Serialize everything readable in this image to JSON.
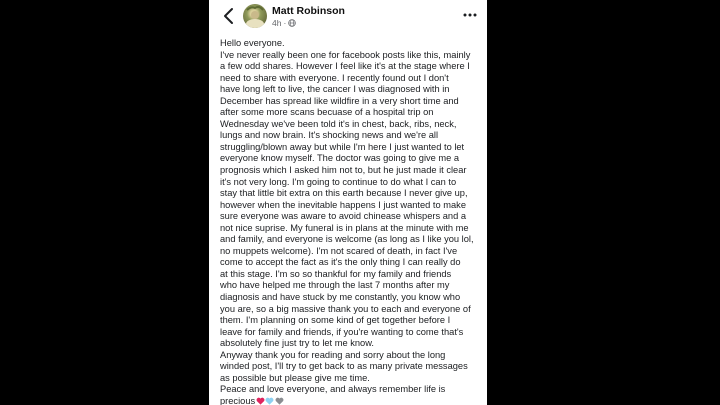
{
  "post": {
    "author": "Matt Robinson",
    "timestamp": "4h",
    "separator": "·",
    "privacy_icon": "globe-icon",
    "lines": [
      "Hello everyone.",
      "I've never really been one for facebook posts like this, mainly",
      "a few odd shares. However I feel like it's at the stage where I",
      "need to share with everyone. I recently found out I don't",
      "have long left to live, the cancer I was diagnosed with in",
      "December has spread like wildfire in a very short time and",
      "after some more scans becuase of a hospital trip on",
      "Wednesday we've been told it's in chest, back, ribs, neck,",
      "lungs and now brain. It's shocking news and we're all",
      "struggling/blown away but while I'm here I just wanted to let",
      "everyone know myself. The doctor was going to give me a",
      "prognosis which I asked him not to, but he just made it clear",
      "it's not very long. I'm going to continue to do what I can to",
      "stay that little bit extra on this earth because I never give up,",
      "however when the inevitable happens I just wanted to make",
      "sure everyone was aware to avoid chinease whispers and a",
      "not nice suprise. My funeral is in plans at the minute with me",
      "and family, and everyone is welcome (as long as I like you lol,",
      "no muppets welcome). I'm not scared of death, in fact I've",
      "come to accept the fact as it's the only thing I can really do",
      "at this stage. I'm so so thankful for my family and friends",
      "who have helped me through the last 7 months after my",
      "diagnosis and have stuck by me constantly, you know who",
      "you are, so a big massive thank you to each and everyone of",
      "them. I'm planning on some kind of get together before I",
      "leave for family and friends, if you're wanting to come that's",
      "absolutely fine just try to let me know.",
      "Anyway thank you for reading and sorry about the long",
      "winded post, I'll try to get back to as many private messages",
      "as possible but please give me time.",
      "Peace and love everyone, and always remember life is"
    ],
    "last_line_text": "precious",
    "hearts": [
      {
        "name": "red-heart-emoji",
        "color": "#e0245e"
      },
      {
        "name": "light-blue-heart-emoji",
        "color": "#8ed1f2"
      },
      {
        "name": "grey-heart-emoji",
        "color": "#8a8d91"
      }
    ]
  },
  "icons": {
    "back": "back-chevron-icon",
    "more": "more-options-icon"
  },
  "colors": {
    "background": "#000000",
    "card": "#ffffff",
    "text": "#1c1e21",
    "secondary": "#65676b"
  }
}
